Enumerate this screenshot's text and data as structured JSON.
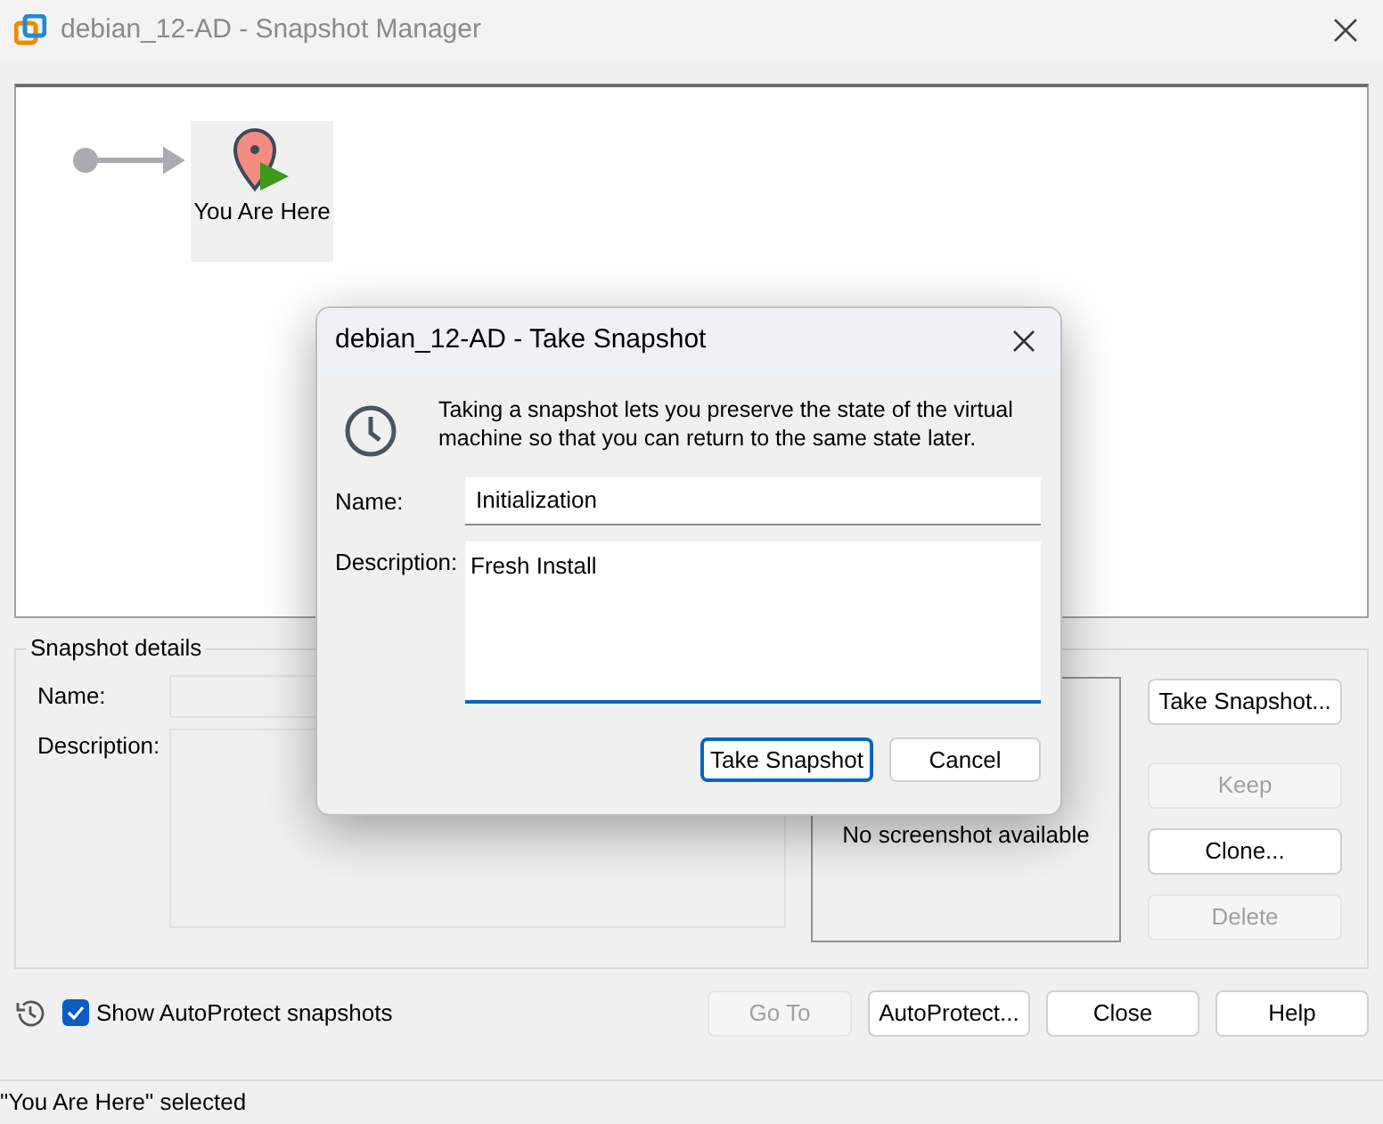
{
  "window": {
    "title": "debian_12-AD - Snapshot Manager"
  },
  "tree": {
    "current": {
      "label": "You Are Here",
      "selected": true
    }
  },
  "details": {
    "legend": "Snapshot details",
    "name_label": "Name:",
    "description_label": "Description:",
    "screenshot_text": "No screenshot available"
  },
  "side_buttons": [
    {
      "label": "Take Snapshot...",
      "disabled": false
    },
    {
      "label": "Keep",
      "disabled": true
    },
    {
      "label": "Clone...",
      "disabled": false
    },
    {
      "label": "Delete",
      "disabled": true
    }
  ],
  "autoprotect": {
    "label": "Show AutoProtect snapshots",
    "checked": true
  },
  "bottom_buttons": [
    {
      "label": "Go To",
      "disabled": true
    },
    {
      "label": "AutoProtect...",
      "disabled": false
    },
    {
      "label": "Close",
      "disabled": false
    },
    {
      "label": "Help",
      "disabled": false
    }
  ],
  "status_bar": "\"You Are Here\" selected",
  "dialog": {
    "title": "debian_12-AD - Take Snapshot",
    "message": "Taking a snapshot lets you preserve the state of the virtual machine so that you can return to the same state later.",
    "name_label": "Name:",
    "name_value": "Initialization",
    "description_label": "Description:",
    "description_value": "Fresh Install",
    "buttons": [
      {
        "label": "Take Snapshot",
        "default": true
      },
      {
        "label": "Cancel",
        "default": false
      }
    ]
  }
}
